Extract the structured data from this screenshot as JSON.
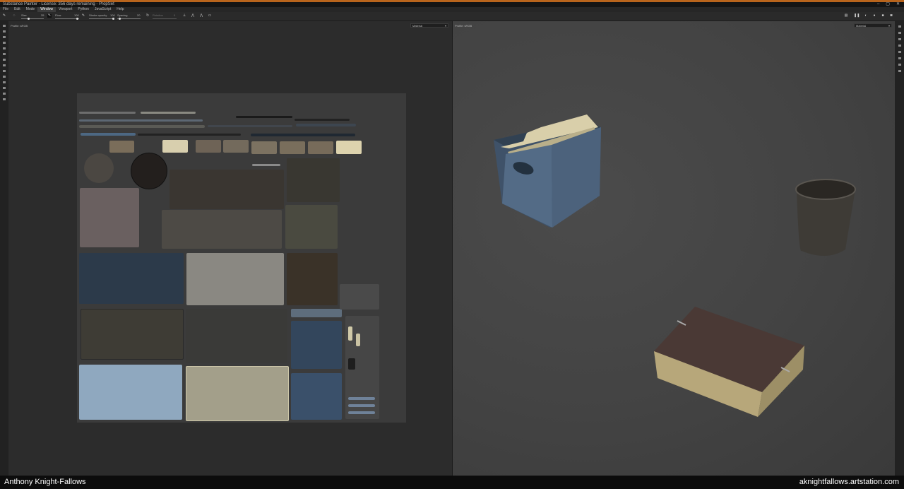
{
  "app": {
    "title": "Substance Painter - License: 356 days remaining - PropSet",
    "window_controls": [
      "–",
      "▢",
      "✕"
    ],
    "accent_color": "#b8641c"
  },
  "menu": {
    "items": [
      "File",
      "Edit",
      "Mode",
      "Window",
      "Viewport",
      "Python",
      "JavaScript",
      "Help"
    ],
    "active": "Window"
  },
  "toolbar": {
    "size_label": "Size",
    "size_value": "35",
    "flow_label": "Flow",
    "flow_value": "100",
    "stroke_opacity_label": "Stroke opacity",
    "stroke_opacity_value": "100",
    "spacing_label": "Spacing",
    "spacing_value": "20",
    "rotation_label": "Rotation",
    "rotation_value": "0",
    "icons": [
      "brush-icon",
      "lazy-mouse-icon",
      "symmetry-icon",
      "camera-icon"
    ]
  },
  "viewport_2d": {
    "profile": "Profile: sRGB",
    "material_select": "Material"
  },
  "viewport_3d": {
    "profile": "Profile: sRGB",
    "material_select": "Material"
  },
  "footer": {
    "author": "Anthony Knight-Fallows",
    "url": "aknightfallows.artstation.com"
  }
}
